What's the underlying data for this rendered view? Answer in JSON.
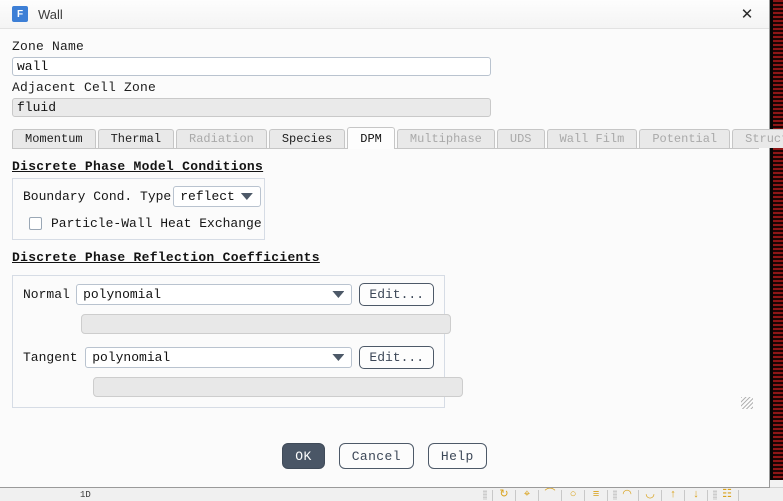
{
  "window": {
    "title": "Wall",
    "app_icon_letter": "F",
    "close_icon": "✕"
  },
  "fields": {
    "zone_name_label": "Zone Name",
    "zone_name_value": "wall",
    "adjacent_cell_zone_label": "Adjacent Cell Zone",
    "adjacent_cell_zone_value": "fluid"
  },
  "tabs": [
    {
      "label": "Momentum",
      "state": "enabled"
    },
    {
      "label": "Thermal",
      "state": "enabled"
    },
    {
      "label": "Radiation",
      "state": "disabled"
    },
    {
      "label": "Species",
      "state": "enabled"
    },
    {
      "label": "DPM",
      "state": "active"
    },
    {
      "label": "Multiphase",
      "state": "disabled"
    },
    {
      "label": "UDS",
      "state": "disabled"
    },
    {
      "label": "Wall Film",
      "state": "disabled"
    },
    {
      "label": "Potential",
      "state": "disabled"
    },
    {
      "label": "Structure",
      "state": "disabled"
    }
  ],
  "dpm": {
    "conditions": {
      "title": "Discrete Phase Model Conditions",
      "bc_type_label": "Boundary Cond. Type",
      "bc_type_value": "reflect",
      "heat_exchange_label": "Particle-Wall Heat Exchange",
      "heat_exchange_checked": false
    },
    "reflection": {
      "title": "Discrete Phase Reflection Coefficients",
      "normal_label": "Normal",
      "normal_value": "polynomial",
      "normal_edit_label": "Edit...",
      "normal_coeff_value": "",
      "tangent_label": "Tangent",
      "tangent_value": "polynomial",
      "tangent_edit_label": "Edit...",
      "tangent_coeff_value": ""
    }
  },
  "footer": {
    "ok_label": "OK",
    "cancel_label": "Cancel",
    "help_label": "Help"
  },
  "background": {
    "toolbar_text": "1D"
  },
  "colors": {
    "primary_button": "#4a5666",
    "title_icon": "#3d7fd6",
    "active_tab": "#fdfdfd",
    "disabled_tab_text": "#a9a9a9",
    "readonly_field": "#eaeaea"
  }
}
